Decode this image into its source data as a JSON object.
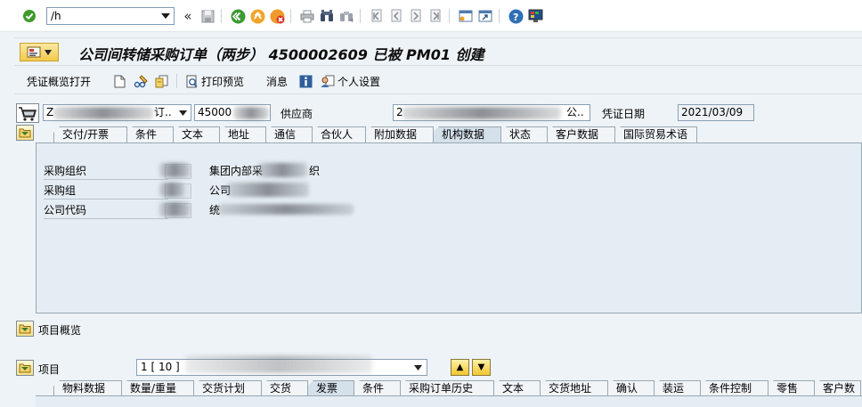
{
  "command_field": {
    "value": "/h"
  },
  "system_toolbar": {
    "icons": [
      "enter-icon",
      "save-icon",
      "back-icon",
      "exit-icon",
      "cancel-icon",
      "print-icon",
      "find-icon",
      "find-next-icon",
      "first-page-icon",
      "previous-page-icon",
      "next-page-icon",
      "last-page-icon",
      "new-session-icon",
      "shortcut-icon",
      "help-icon",
      "customize-layout-icon"
    ],
    "chevron": "«"
  },
  "title": {
    "text": "公司间转储采购订单（两步） 4500002609 已被 PM01 创建"
  },
  "app_toolbar": {
    "doc_overview": "凭证概览打开",
    "print_preview": "打印预览",
    "messages": "消息",
    "personal_settings": "个人设置"
  },
  "header": {
    "doc_type_visible": "Z",
    "doc_type_suffix": "订..",
    "po_number_visible": "45000",
    "supplier_label": "供应商",
    "supplier_visible": "2",
    "supplier_suffix": "公..",
    "doc_date_label": "凭证日期",
    "doc_date": "2021/03/09"
  },
  "header_tabs": [
    {
      "label": "交付/开票",
      "active": false
    },
    {
      "label": "条件",
      "active": false
    },
    {
      "label": "文本",
      "active": false
    },
    {
      "label": "地址",
      "active": false
    },
    {
      "label": "通信",
      "active": false
    },
    {
      "label": "合伙人",
      "active": false
    },
    {
      "label": "附加数据",
      "active": false
    },
    {
      "label": "机构数据",
      "active": true
    },
    {
      "label": "状态",
      "active": false
    },
    {
      "label": "客户数据",
      "active": false
    },
    {
      "label": "国际贸易术语",
      "active": false
    }
  ],
  "org_data": [
    {
      "label": "采购组织",
      "desc_visible": "集团内部采",
      "desc_tail": "织"
    },
    {
      "label": "采购组",
      "desc_visible": "公司",
      "desc_tail": ""
    },
    {
      "label": "公司代码",
      "desc_visible": "统",
      "desc_tail": ""
    }
  ],
  "item_overview": {
    "label": "项目概览"
  },
  "item_section": {
    "label": "项目",
    "select_value_visible": "1 [ 10 ]",
    "up_arrow": "▲",
    "down_arrow": "▼"
  },
  "item_tabs": [
    {
      "label": "物料数据",
      "active": false
    },
    {
      "label": "数量/重量",
      "active": false
    },
    {
      "label": "交货计划",
      "active": false
    },
    {
      "label": "交货",
      "active": false
    },
    {
      "label": "发票",
      "active": true
    },
    {
      "label": "条件",
      "active": false
    },
    {
      "label": "采购订单历史",
      "active": false
    },
    {
      "label": "文本",
      "active": false
    },
    {
      "label": "交货地址",
      "active": false
    },
    {
      "label": "确认",
      "active": false
    },
    {
      "label": "装运",
      "active": false
    },
    {
      "label": "条件控制",
      "active": false
    },
    {
      "label": "零售",
      "active": false
    },
    {
      "label": "客户数",
      "active": false
    }
  ]
}
